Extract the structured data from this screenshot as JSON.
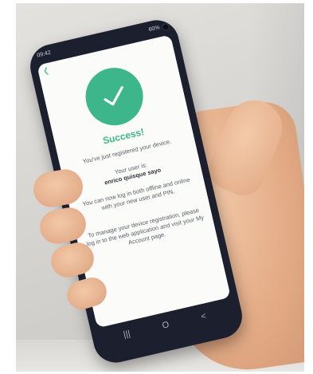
{
  "status_bar": {
    "time": "09:42",
    "battery": "60%"
  },
  "app": {
    "title": "Success!",
    "message_registered": "You've just registered your device.",
    "message_user_label": "Your user is:",
    "message_user_value": "enrico quisque sayo",
    "message_login": "You can now log in both offline and online with your new user and PIN.",
    "message_manage": "To manage your device registration, please log in to the web application and visit your My Account page."
  },
  "nav": {
    "recent": "|||",
    "home": "O",
    "back": "<"
  },
  "colors": {
    "accent": "#3db68b",
    "phone_body": "#1b1f2e",
    "screen": "#fbfbf9"
  },
  "icons": {
    "success": "checkmark-icon",
    "back_arrow": "chevron-left-icon"
  }
}
